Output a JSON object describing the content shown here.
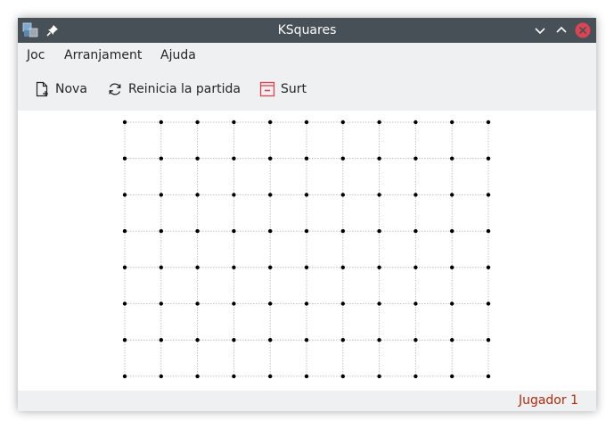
{
  "window": {
    "title": "KSquares"
  },
  "menubar": {
    "items": [
      "Joc",
      "Arranjament",
      "Ajuda"
    ]
  },
  "toolbar": {
    "new_label": "Nova",
    "restart_label": "Reinicia la partida",
    "quit_label": "Surt"
  },
  "board": {
    "columns": 11,
    "rows": 8,
    "dot_color": "#000000",
    "grid_line_color": "#b4b4b4"
  },
  "statusbar": {
    "player_text": "Jugador 1",
    "player_color": "#b22a0b"
  },
  "colors": {
    "titlebar": "#475057",
    "chrome": "#eff0f1",
    "close_button": "#da4453",
    "quit_icon": "#da4453"
  }
}
